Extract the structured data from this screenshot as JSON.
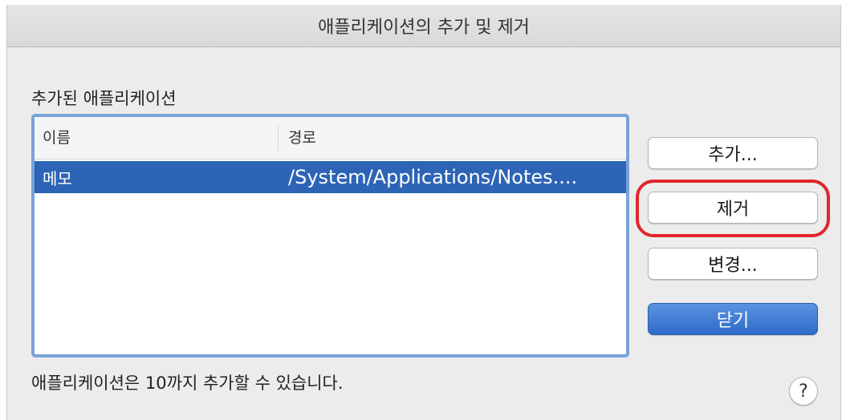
{
  "window": {
    "title": "애플리케이션의 추가 및 제거"
  },
  "section": {
    "label": "추가된 애플리케이션"
  },
  "table": {
    "columns": [
      "이름",
      "경로"
    ],
    "rows": [
      {
        "name": "메모",
        "path": "/System/Applications/Notes....",
        "selected": true
      }
    ]
  },
  "buttons": {
    "add": "추가...",
    "remove": "제거",
    "change": "변경...",
    "close": "닫기",
    "help": "?"
  },
  "footer": {
    "note": "애플리케이션은 10까지 추가할 수 있습니다."
  },
  "colors": {
    "selection": "#2d64b5",
    "focus_ring": "#79a3d8",
    "highlight": "#e0262b",
    "default_button": "#2f6bc9"
  },
  "icons": {
    "help": "question-mark-icon"
  }
}
